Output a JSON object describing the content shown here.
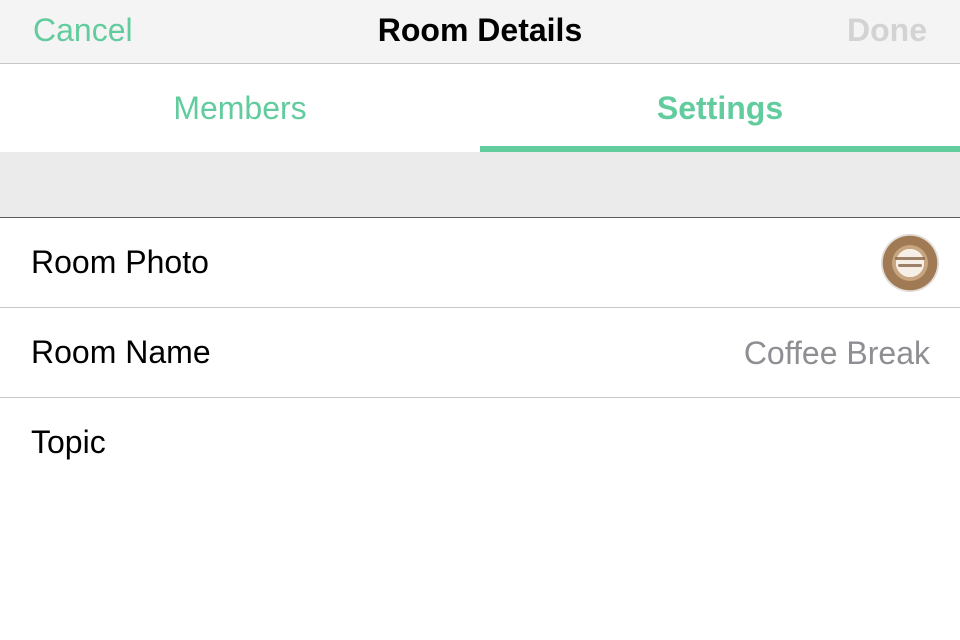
{
  "navbar": {
    "cancel_label": "Cancel",
    "title": "Room Details",
    "done_label": "Done"
  },
  "tabs": [
    {
      "label": "Members",
      "selected": false
    },
    {
      "label": "Settings",
      "selected": true
    }
  ],
  "settings": {
    "room_photo": {
      "label": "Room Photo",
      "image": "coffee-latte-art-photo"
    },
    "room_name": {
      "label": "Room Name",
      "value": "Coffee Break"
    },
    "topic": {
      "label": "Topic",
      "value": ""
    }
  },
  "colors": {
    "accent": "#62cc9e",
    "disabled": "#d3d3d3",
    "secondary_text": "#8e8e93",
    "nav_background": "#f4f4f4",
    "section_background": "#ebebeb"
  }
}
